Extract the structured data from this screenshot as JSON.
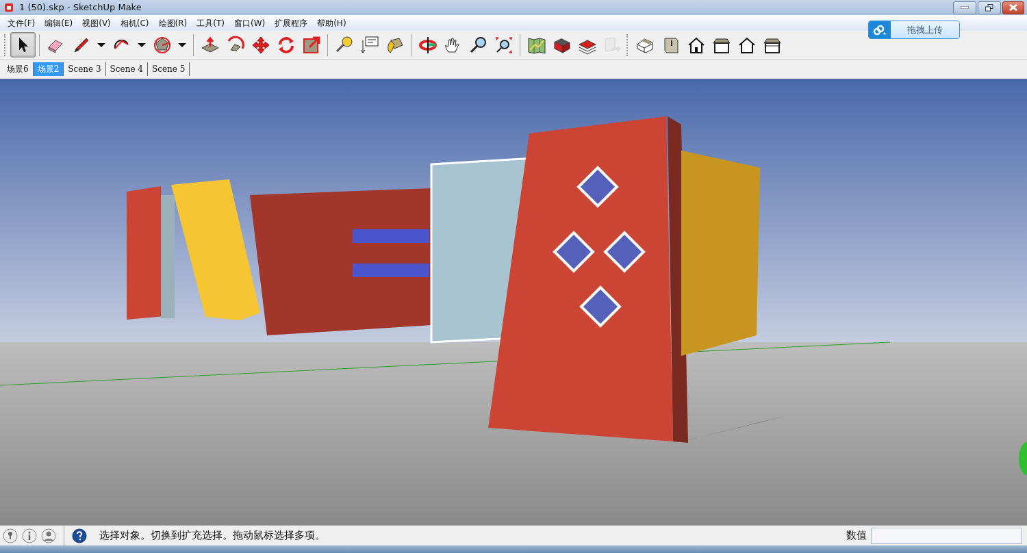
{
  "window": {
    "title": "1 (50).skp - SketchUp Make"
  },
  "menu": [
    "文件(F)",
    "编辑(E)",
    "视图(V)",
    "相机(C)",
    "绘图(R)",
    "工具(T)",
    "窗口(W)",
    "扩展程序",
    "帮助(H)"
  ],
  "upload_button": {
    "label": "拖拽上传"
  },
  "tools": [
    {
      "kind": "select",
      "selected": true,
      "disabled": false
    },
    {
      "kind": "separator"
    },
    {
      "kind": "eraser",
      "selected": false,
      "disabled": false
    },
    {
      "kind": "pencil",
      "selected": false,
      "disabled": false
    },
    {
      "kind": "dropdown",
      "selected": false,
      "disabled": false
    },
    {
      "kind": "arc",
      "selected": false,
      "disabled": false
    },
    {
      "kind": "dropdown",
      "selected": false,
      "disabled": false
    },
    {
      "kind": "polygon",
      "selected": false,
      "disabled": false
    },
    {
      "kind": "dropdown",
      "selected": false,
      "disabled": false
    },
    {
      "kind": "separator"
    },
    {
      "kind": "pushpull",
      "selected": false,
      "disabled": false
    },
    {
      "kind": "followme",
      "selected": false,
      "disabled": false
    },
    {
      "kind": "move",
      "selected": false,
      "disabled": false
    },
    {
      "kind": "rotate",
      "selected": false,
      "disabled": false
    },
    {
      "kind": "scale",
      "selected": false,
      "disabled": false
    },
    {
      "kind": "separator"
    },
    {
      "kind": "tape",
      "selected": false,
      "disabled": false
    },
    {
      "kind": "text",
      "selected": false,
      "disabled": false
    },
    {
      "kind": "paint",
      "selected": false,
      "disabled": false
    },
    {
      "kind": "separator"
    },
    {
      "kind": "orbit",
      "selected": false,
      "disabled": false
    },
    {
      "kind": "pan",
      "selected": false,
      "disabled": false
    },
    {
      "kind": "zoom",
      "selected": false,
      "disabled": false
    },
    {
      "kind": "zoomext",
      "selected": false,
      "disabled": false
    },
    {
      "kind": "separator"
    },
    {
      "kind": "map",
      "selected": false,
      "disabled": false
    },
    {
      "kind": "warehouse",
      "selected": false,
      "disabled": false
    },
    {
      "kind": "components",
      "selected": false,
      "disabled": false
    },
    {
      "kind": "share",
      "selected": false,
      "disabled": true
    },
    {
      "kind": "gap"
    },
    {
      "kind": "iso",
      "selected": false,
      "disabled": false
    },
    {
      "kind": "top",
      "selected": false,
      "disabled": false
    },
    {
      "kind": "front",
      "selected": false,
      "disabled": false
    },
    {
      "kind": "right",
      "selected": false,
      "disabled": false
    },
    {
      "kind": "back",
      "selected": false,
      "disabled": false
    },
    {
      "kind": "left",
      "selected": false,
      "disabled": false
    }
  ],
  "scenes": [
    {
      "label": "场景6",
      "selected": false
    },
    {
      "label": "场景2",
      "selected": true
    },
    {
      "label": "Scene 3",
      "selected": false
    },
    {
      "label": "Scene 4",
      "selected": false
    },
    {
      "label": "Scene 5",
      "selected": false
    }
  ],
  "status_bar": {
    "message": "选择对象。切换到扩充选择。拖动鼠标选择多项。",
    "measurements_label": "数值"
  }
}
